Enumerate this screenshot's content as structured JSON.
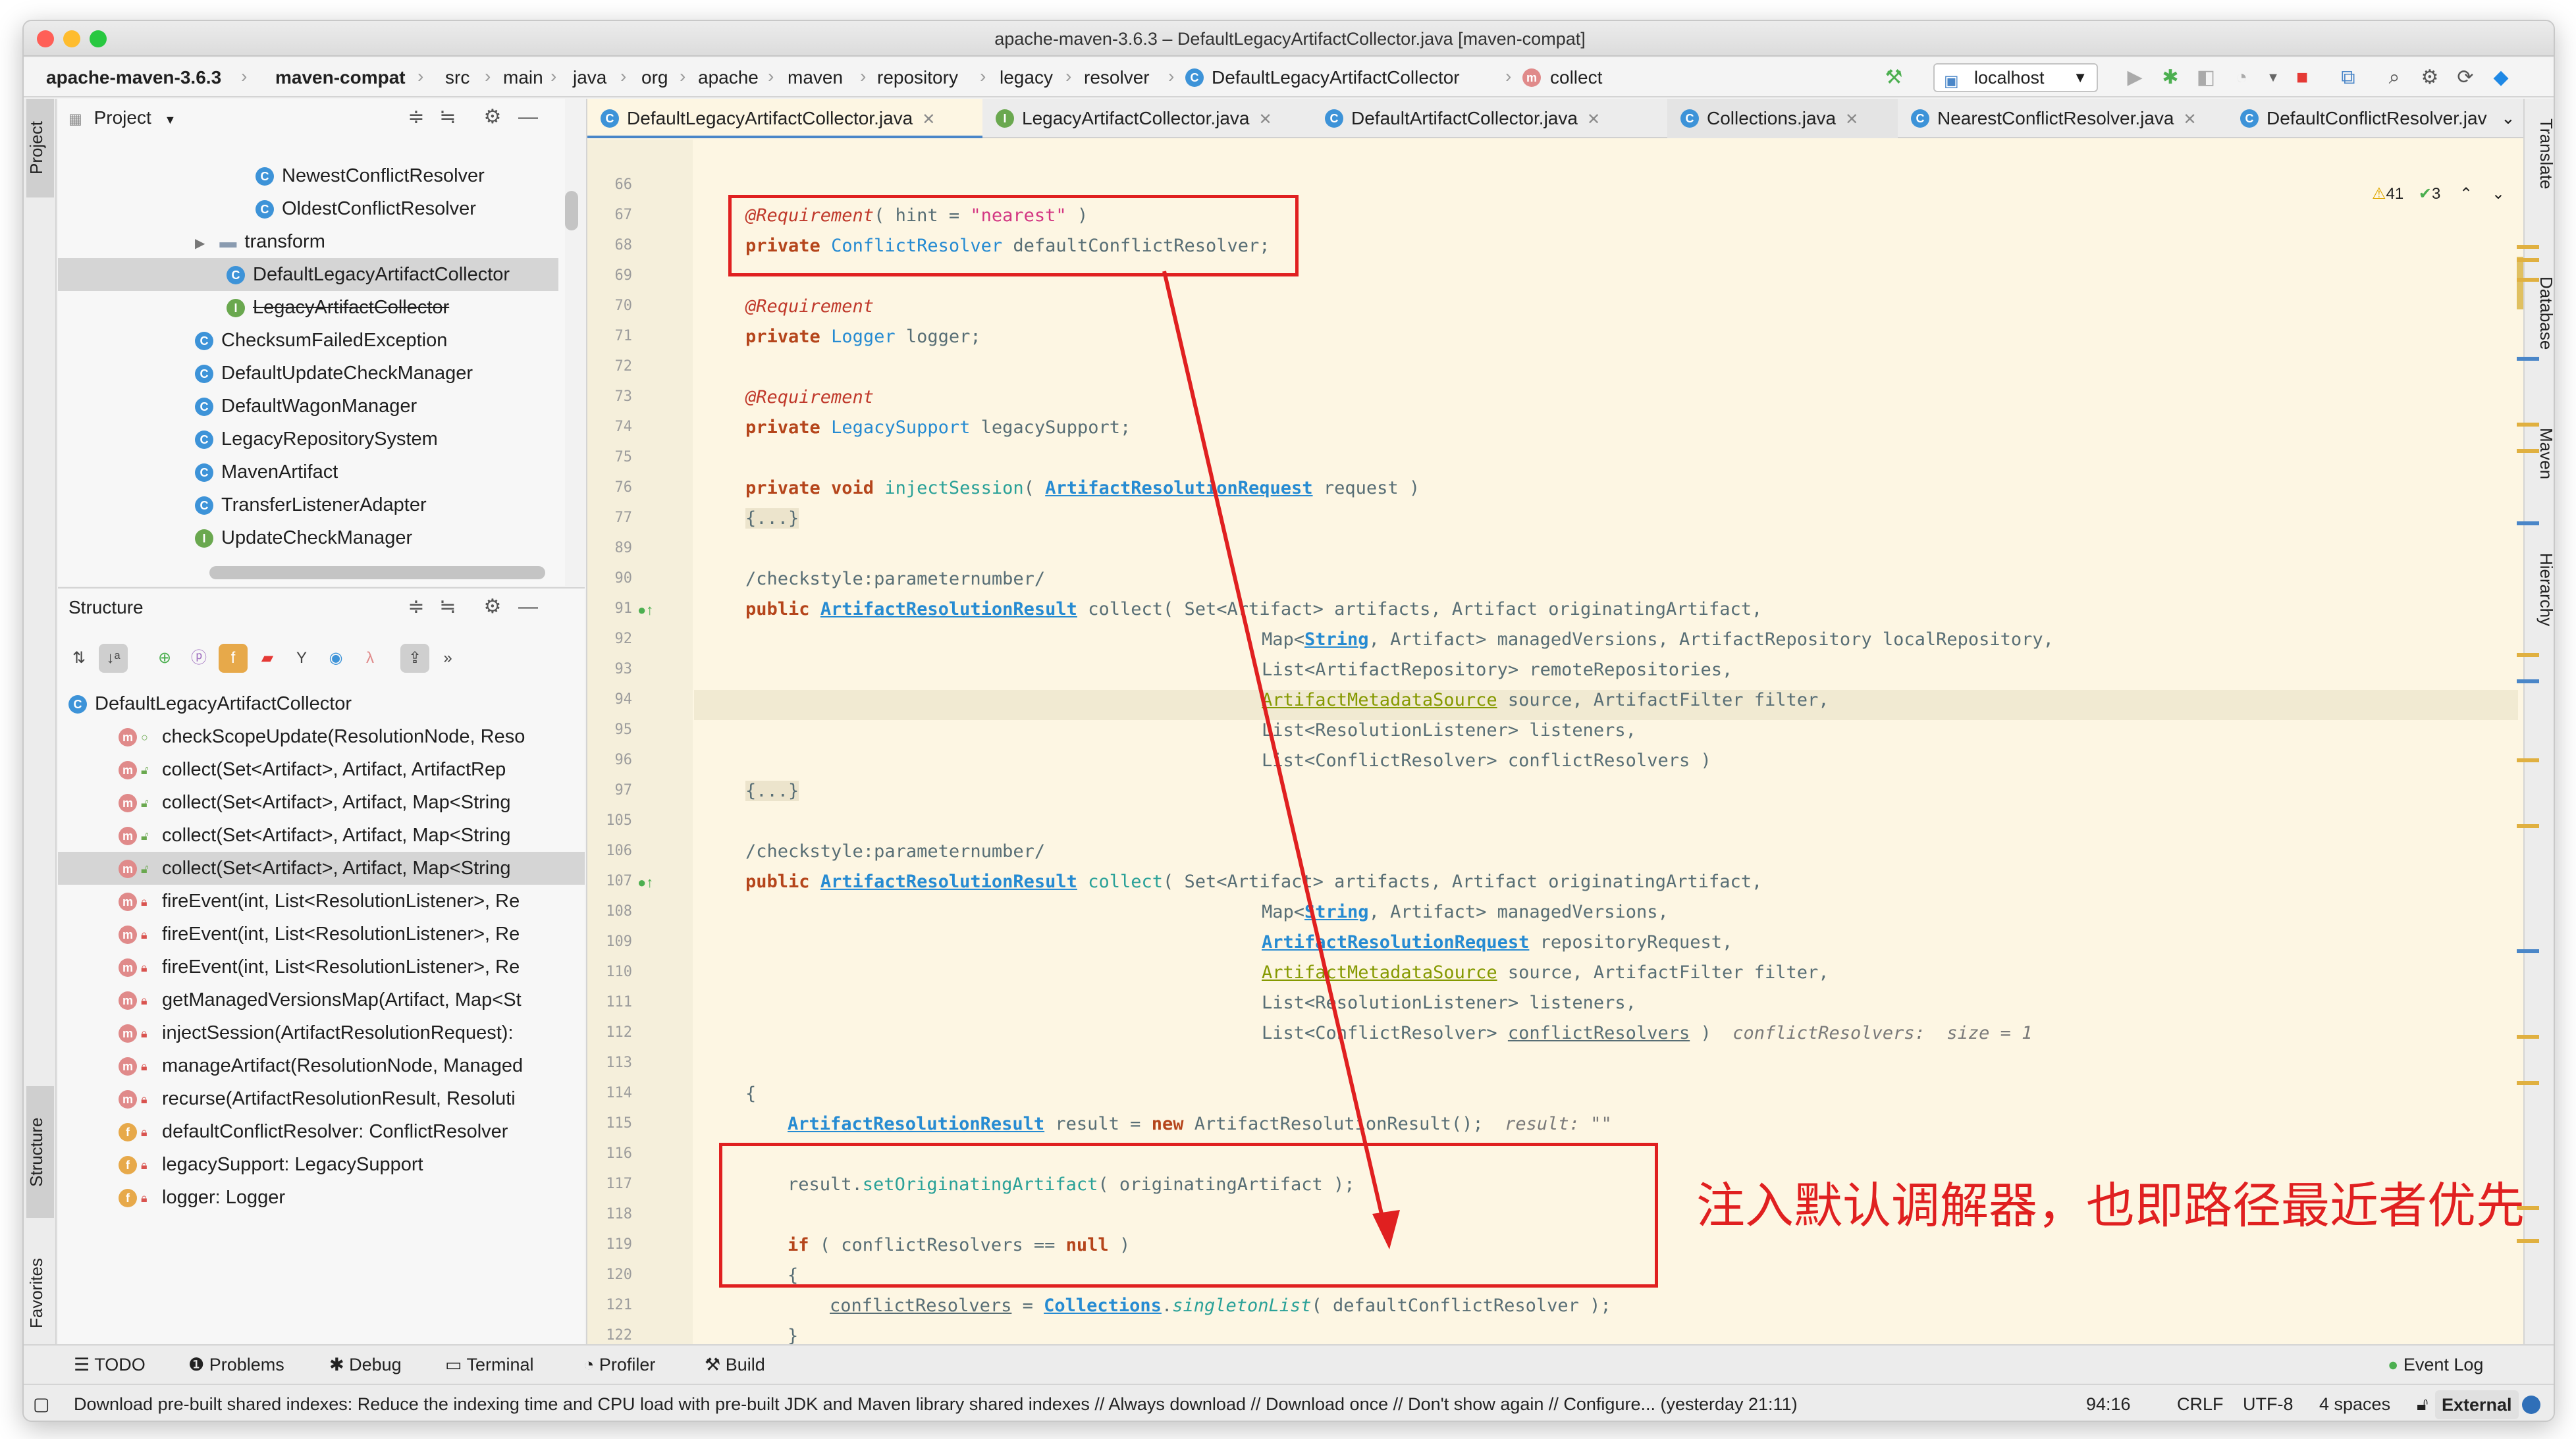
{
  "window": {
    "title": "apache-maven-3.6.3 – DefaultLegacyArtifactCollector.java [maven-compat]"
  },
  "breadcrumbs": [
    "apache-maven-3.6.3",
    "maven-compat",
    "src",
    "main",
    "java",
    "org",
    "apache",
    "maven",
    "repository",
    "legacy",
    "resolver",
    "DefaultLegacyArtifactCollector",
    "collect"
  ],
  "toolbar": {
    "run_config": "localhost"
  },
  "project_panel": {
    "title": "Project",
    "items": [
      {
        "label": "NewestConflictResolver",
        "icon": "class-icon"
      },
      {
        "label": "OldestConflictResolver",
        "icon": "class-icon"
      },
      {
        "label": "transform",
        "icon": "folder-icon"
      },
      {
        "label": "DefaultLegacyArtifactCollector",
        "icon": "class-icon"
      },
      {
        "label": "LegacyArtifactCollector",
        "icon": "interface-icon"
      },
      {
        "label": "ChecksumFailedException",
        "icon": "class-icon"
      },
      {
        "label": "DefaultUpdateCheckManager",
        "icon": "class-icon"
      },
      {
        "label": "DefaultWagonManager",
        "icon": "class-icon"
      },
      {
        "label": "LegacyRepositorySystem",
        "icon": "class-icon"
      },
      {
        "label": "MavenArtifact",
        "icon": "class-icon"
      },
      {
        "label": "TransferListenerAdapter",
        "icon": "class-icon"
      },
      {
        "label": "UpdateCheckManager",
        "icon": "interface-icon"
      }
    ]
  },
  "structure_panel": {
    "title": "Structure",
    "root": "DefaultLegacyArtifactCollector",
    "members": [
      {
        "label": "checkScopeUpdate(ResolutionNode, Reso",
        "kind": "m"
      },
      {
        "label": "collect(Set<Artifact>, Artifact, ArtifactRep",
        "kind": "m"
      },
      {
        "label": "collect(Set<Artifact>, Artifact, Map<String",
        "kind": "m"
      },
      {
        "label": "collect(Set<Artifact>, Artifact, Map<String",
        "kind": "m"
      },
      {
        "label": "collect(Set<Artifact>, Artifact, Map<String",
        "kind": "m"
      },
      {
        "label": "fireEvent(int, List<ResolutionListener>, Re",
        "kind": "m"
      },
      {
        "label": "fireEvent(int, List<ResolutionListener>, Re",
        "kind": "m"
      },
      {
        "label": "fireEvent(int, List<ResolutionListener>, Re",
        "kind": "m"
      },
      {
        "label": "getManagedVersionsMap(Artifact, Map<St",
        "kind": "m"
      },
      {
        "label": "injectSession(ArtifactResolutionRequest):",
        "kind": "m"
      },
      {
        "label": "manageArtifact(ResolutionNode, Managed",
        "kind": "m"
      },
      {
        "label": "recurse(ArtifactResolutionResult, Resoluti",
        "kind": "m"
      },
      {
        "label": "defaultConflictResolver: ConflictResolver",
        "kind": "f"
      },
      {
        "label": "legacySupport: LegacySupport",
        "kind": "f"
      },
      {
        "label": "logger: Logger",
        "kind": "f"
      }
    ]
  },
  "editor_tabs": [
    "DefaultLegacyArtifactCollector.java",
    "LegacyArtifactCollector.java",
    "DefaultArtifactCollector.java",
    "Collections.java",
    "NearestConflictResolver.java",
    "DefaultConflictResolver.jav"
  ],
  "inspections": {
    "warnings": "41",
    "weak_warnings": "3"
  },
  "line_numbers": [
    "66",
    "67",
    "68",
    "69",
    "70",
    "71",
    "72",
    "73",
    "74",
    "75",
    "76",
    "77",
    "89",
    "90",
    "91",
    "92",
    "93",
    "94",
    "95",
    "96",
    "97",
    "105",
    "106",
    "107",
    "108",
    "109",
    "110",
    "111",
    "112",
    "113",
    "114",
    "115",
    "116",
    "117",
    "118",
    "119",
    "120",
    "121",
    "122"
  ],
  "code": {
    "l67_ann": "@Requirement",
    "l67_rest": "( hint = ",
    "l67_str": "\"nearest\"",
    "l67_end": " )",
    "l68_kw": "private",
    "l68_type": "ConflictResolver",
    "l68_var": " defaultConflictResolver;",
    "l70_ann": "@Requirement",
    "l71_kw": "private",
    "l71_type": "Logger",
    "l71_var": " logger;",
    "l73_ann": "@Requirement",
    "l74_kw": "private",
    "l74_type": "LegacySupport",
    "l74_var": " legacySupport;",
    "l76_kw": "private void",
    "l76_fn": "injectSession",
    "l76_p": "( ",
    "l76_type": "ArtifactResolutionRequest",
    "l76_var": " request )",
    "fold": "{...}",
    "cs_comment": "/checkstyle:parameternumber/",
    "pub": "public",
    "result_type": "ArtifactResolutionResult",
    "collect": "collect",
    "l91_args": "( Set<Artifact> artifacts, Artifact originatingArtifact,",
    "l92_a": "Map<",
    "l92_b": "String",
    "l92_c": ", Artifact> managedVersions, ArtifactRepository localRepository,",
    "l93": "List<ArtifactRepository> remoteRepositories,",
    "l94_a": "ArtifactMetadataSource",
    "l94_b": " source, ArtifactFilter filter,",
    "l95": "List<ResolutionListener> listeners,",
    "l96": "List<ConflictResolver> conflictResolvers )",
    "l107_args": "( Set<Artifact> artifacts, Artifact originatingArtifact,",
    "l108_a": "Map<",
    "l108_b": "String",
    "l108_c": ", Artifact> managedVersions,",
    "l109_a": "ArtifactResolutionRequest",
    "l109_b": " repositoryRequest,",
    "l110_a": "ArtifactMetadataSource",
    "l110_b": " source, ArtifactFilter filter,",
    "l111": "List<ResolutionListener> listeners,",
    "l112_a": "List<ConflictResolver> ",
    "l112_b": "conflictResolvers",
    "l112_c": " )",
    "l112_hint": "conflictResolvers:  size = 1",
    "brace_open": "{",
    "brace_close": "}",
    "l114_type": "ArtifactResolutionResult",
    "l114_mid": " result = ",
    "l114_new": "new",
    "l114_end": " ArtifactResolutionResult();",
    "l114_hint": "result: \"\"",
    "l116_a": "result.",
    "l116_fn": "setOriginatingArtifact",
    "l116_b": "( originatingArtifact );",
    "l118_if": "if",
    "l118_mid": " ( conflictResolvers == ",
    "l118_null": "null",
    "l118_end": " )",
    "l120_a": "conflictResolvers",
    "l120_b": " = ",
    "l120_c": "Collections",
    "l120_d": ".",
    "l120_fn": "singletonList",
    "l120_e": "( defaultConflictResolver );"
  },
  "annotation": "注入默认调解器，也即路径最近者优先",
  "right_strip": [
    "Translate",
    "Database",
    "Maven",
    "Hierarchy"
  ],
  "left_strip": [
    "Project",
    "Structure",
    "Favorites"
  ],
  "tool_windows": [
    "TODO",
    "Problems",
    "Debug",
    "Terminal",
    "Profiler",
    "Build"
  ],
  "event_log": "Event Log",
  "status": {
    "message": "Download pre-built shared indexes: Reduce the indexing time and CPU load with pre-built JDK and Maven library shared indexes // Always download // Download once // Don't show again // Configure... (yesterday 21:11)",
    "position": "94:16",
    "line_sep": "CRLF",
    "encoding": "UTF-8",
    "indent": "4 spaces",
    "mode": "External"
  },
  "colors": {
    "annotation_red": "#e02020",
    "editor_bg": "#fdf6e3",
    "accent": "#4a86c8"
  }
}
